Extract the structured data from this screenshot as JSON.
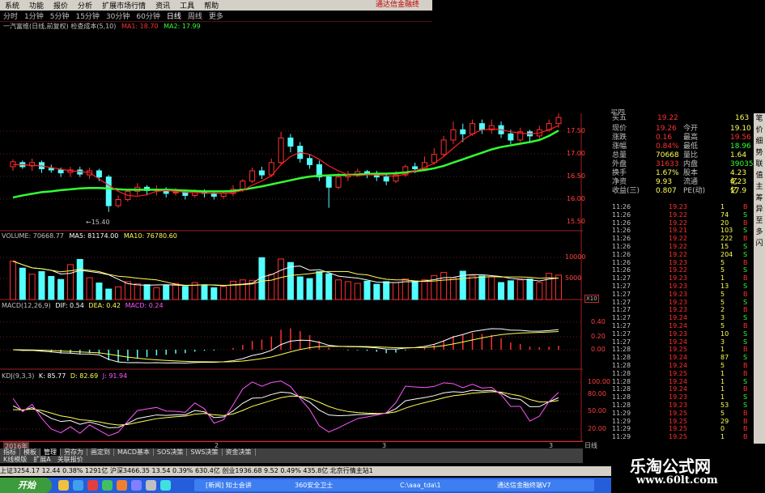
{
  "menu": [
    "系统",
    "功能",
    "报价",
    "分析",
    "扩展市场行情",
    "资讯",
    "工具",
    "帮助"
  ],
  "brand": "通达信金融终",
  "periods": [
    "分时",
    "1分钟",
    "5分钟",
    "15分钟",
    "30分钟",
    "60分钟",
    "日线",
    "周线",
    "更多"
  ],
  "active_period": "日线",
  "header": {
    "stock": "一汽富维(日线,前复权)",
    "indicator": "检查成本(5,10)",
    "ma1": "MA1: 18.70",
    "ma2": "MA2: 17.99"
  },
  "price_axis": [
    "17.50",
    "17.00",
    "16.50",
    "16.00",
    "15.50"
  ],
  "low_label": "15.40",
  "volume_header": {
    "label": "VOLUME: 70668.77",
    "ma5": "MA5: 81174.00",
    "ma10": "MA10: 76780.60"
  },
  "volume_axis": [
    "10000",
    "5000"
  ],
  "volume_unit": "X10",
  "macd_header": {
    "label": "MACD(12,26,9)",
    "dif": "DIF: 0.54",
    "dea": "DEA: 0.42",
    "macd": "MACD: 0.24"
  },
  "macd_axis": [
    "0.40",
    "0.20",
    "0.00"
  ],
  "kdj_header": {
    "label": "KDJ(9,3,3)",
    "k": "K: 85.77",
    "d": "D: 82.69",
    "j": "J: 91.94"
  },
  "kdj_axis": [
    "100.00",
    "80.00",
    "50.00",
    "20.00"
  ],
  "date_label": "2016年",
  "time_marks": [
    "2",
    "3",
    "3"
  ],
  "period_label": "日线",
  "quote": {
    "top_cut": "买四",
    "buy5": {
      "label": "买五",
      "price": "19.22",
      "vol": "163"
    },
    "rows": [
      {
        "l1": "现价",
        "v1": "19.26",
        "l2": "今开",
        "v2": "19.10"
      },
      {
        "l1": "涨跌",
        "v1": "0.16",
        "l2": "最高",
        "v2": "19.56"
      },
      {
        "l1": "涨幅",
        "v1": "0.84%",
        "l2": "最低",
        "v2": "18.96"
      },
      {
        "l1": "总量",
        "v1": "70668",
        "l2": "量比",
        "v2": "1.64"
      },
      {
        "l1": "外盘",
        "v1": "31633",
        "l2": "内盘",
        "v2": "39035"
      },
      {
        "l1": "换手",
        "v1": "1.67%",
        "l2": "股本",
        "v2": "4.23亿"
      },
      {
        "l1": "净资",
        "v1": "9.93",
        "l2": "流通",
        "v2": "4.23亿"
      },
      {
        "l1": "收益(三)",
        "v1": "0.807",
        "l2": "PE(动)",
        "v2": "17.9"
      }
    ],
    "ticks": [
      {
        "t": "11:26",
        "p": "19.23",
        "v": "1",
        "d": "B"
      },
      {
        "t": "11:26",
        "p": "19.22",
        "v": "74",
        "d": "S"
      },
      {
        "t": "11:26",
        "p": "19.22",
        "v": "20",
        "d": "B"
      },
      {
        "t": "11:26",
        "p": "19.21",
        "v": "103",
        "d": "S"
      },
      {
        "t": "11:26",
        "p": "19.22",
        "v": "222",
        "d": "B"
      },
      {
        "t": "11:26",
        "p": "19.22",
        "v": "15",
        "d": "S"
      },
      {
        "t": "11:26",
        "p": "19.22",
        "v": "204",
        "d": "S"
      },
      {
        "t": "11:26",
        "p": "19.23",
        "v": "5",
        "d": "B"
      },
      {
        "t": "11:26",
        "p": "19.22",
        "v": "5",
        "d": "S"
      },
      {
        "t": "11:27",
        "p": "19.23",
        "v": "1",
        "d": "B"
      },
      {
        "t": "11:27",
        "p": "19.23",
        "v": "13",
        "d": "S"
      },
      {
        "t": "11:27",
        "p": "19.23",
        "v": "5",
        "d": "B"
      },
      {
        "t": "11:27",
        "p": "19.23",
        "v": "5",
        "d": "S"
      },
      {
        "t": "11:27",
        "p": "19.23",
        "v": "2",
        "d": "B"
      },
      {
        "t": "11:27",
        "p": "19.24",
        "v": "3",
        "d": "S"
      },
      {
        "t": "11:27",
        "p": "19.24",
        "v": "5",
        "d": "B"
      },
      {
        "t": "11:27",
        "p": "19.23",
        "v": "10",
        "d": "S"
      },
      {
        "t": "11:27",
        "p": "19.24",
        "v": "3",
        "d": "S"
      },
      {
        "t": "11:28",
        "p": "19.25",
        "v": "1",
        "d": "B"
      },
      {
        "t": "11:28",
        "p": "19.24",
        "v": "87",
        "d": "S"
      },
      {
        "t": "11:28",
        "p": "19.24",
        "v": "5",
        "d": "B"
      },
      {
        "t": "11:28",
        "p": "19.25",
        "v": "1",
        "d": "B"
      },
      {
        "t": "11:28",
        "p": "19.24",
        "v": "1",
        "d": "S"
      },
      {
        "t": "11:28",
        "p": "19.24",
        "v": "1",
        "d": "B"
      },
      {
        "t": "11:28",
        "p": "19.23",
        "v": "1",
        "d": "S"
      },
      {
        "t": "11:28",
        "p": "19.23",
        "v": "53",
        "d": "S"
      },
      {
        "t": "11:29",
        "p": "19.25",
        "v": "5",
        "d": "B"
      },
      {
        "t": "11:29",
        "p": "19.25",
        "v": "29",
        "d": "B"
      },
      {
        "t": "11:29",
        "p": "19.25",
        "v": "0",
        "d": "B"
      },
      {
        "t": "11:29",
        "p": "19.25",
        "v": "1",
        "d": "B"
      }
    ]
  },
  "side_tabs": [
    "笔",
    "价",
    "细",
    "势",
    "联",
    "值",
    "主",
    "筹",
    "异",
    "至",
    "多",
    "闪"
  ],
  "subtabs": [
    "指标",
    "模板",
    "管理",
    "另存为",
    "画定到",
    "MACD基本",
    "SOS决策",
    "SWS决策",
    "资金决策"
  ],
  "subtabs2": [
    "K线模版",
    "扩展A",
    "关联报价"
  ],
  "status_bar": "上证3254.17  12.44  0.38%  1291亿  沪深3466.35  13.54  0.39%  630.4亿  创业1936.68  9.52  0.49%  435.8亿    北京行情主站1",
  "taskbar": {
    "start": "开始",
    "tasks": [
      "[新闻] 知士会讲",
      "360安全卫士",
      "C:\\aaa_tda\\1",
      "通达信金融终端V7"
    ]
  },
  "watermark": {
    "line1": "乐淘公式网",
    "line2": "www.60lt.com"
  },
  "chart_data": {
    "type": "candlestick",
    "price_ylim": [
      15.3,
      18.1
    ],
    "candles": [
      [
        16.8,
        16.92,
        16.7,
        16.98
      ],
      [
        16.9,
        16.8,
        16.75,
        16.95
      ],
      [
        16.82,
        16.9,
        16.7,
        17.0
      ],
      [
        16.9,
        16.75,
        16.65,
        16.95
      ],
      [
        16.76,
        16.72,
        16.65,
        16.85
      ],
      [
        16.72,
        16.65,
        16.55,
        16.78
      ],
      [
        16.66,
        16.72,
        16.55,
        16.8
      ],
      [
        16.72,
        16.62,
        16.55,
        16.8
      ],
      [
        16.6,
        16.7,
        16.5,
        16.78
      ],
      [
        16.7,
        16.55,
        16.45,
        16.75
      ],
      [
        16.55,
        15.85,
        15.7,
        16.6
      ],
      [
        15.85,
        16.0,
        15.8,
        16.1
      ],
      [
        16.0,
        16.2,
        15.95,
        16.25
      ],
      [
        16.2,
        16.3,
        16.1,
        16.4
      ],
      [
        16.3,
        16.22,
        16.1,
        16.35
      ],
      [
        16.22,
        16.25,
        16.1,
        16.35
      ],
      [
        16.25,
        16.15,
        16.05,
        16.3
      ],
      [
        16.16,
        16.18,
        16.1,
        16.28
      ],
      [
        16.18,
        16.1,
        16.0,
        16.25
      ],
      [
        16.1,
        16.2,
        16.05,
        16.25
      ],
      [
        16.2,
        16.15,
        16.05,
        16.25
      ],
      [
        16.15,
        16.08,
        16.0,
        16.22
      ],
      [
        16.08,
        16.15,
        16.02,
        16.2
      ],
      [
        16.15,
        16.25,
        16.08,
        16.35
      ],
      [
        16.25,
        16.45,
        16.18,
        16.5
      ],
      [
        16.45,
        16.7,
        16.4,
        16.78
      ],
      [
        16.7,
        16.6,
        16.5,
        16.8
      ],
      [
        16.6,
        16.9,
        16.55,
        17.0
      ],
      [
        16.9,
        17.5,
        16.85,
        17.65
      ],
      [
        17.5,
        17.3,
        17.15,
        17.6
      ],
      [
        17.3,
        17.0,
        16.9,
        17.4
      ],
      [
        17.0,
        16.85,
        16.75,
        17.1
      ],
      [
        16.85,
        16.55,
        16.45,
        16.95
      ],
      [
        16.55,
        16.3,
        15.8,
        16.6
      ],
      [
        16.3,
        16.55,
        16.25,
        16.65
      ],
      [
        16.55,
        16.62,
        16.45,
        16.7
      ],
      [
        16.62,
        16.68,
        16.55,
        16.75
      ],
      [
        16.68,
        16.62,
        16.52,
        16.72
      ],
      [
        16.62,
        16.55,
        16.45,
        16.7
      ],
      [
        16.55,
        16.45,
        16.35,
        16.62
      ],
      [
        16.45,
        16.6,
        16.4,
        16.7
      ],
      [
        16.6,
        16.8,
        16.55,
        16.85
      ],
      [
        16.8,
        16.75,
        16.65,
        16.9
      ],
      [
        16.75,
        16.9,
        16.7,
        17.05
      ],
      [
        16.9,
        17.1,
        16.85,
        17.25
      ],
      [
        17.1,
        17.45,
        17.05,
        17.55
      ],
      [
        17.45,
        17.7,
        17.35,
        17.9
      ],
      [
        17.7,
        17.6,
        17.4,
        17.85
      ],
      [
        17.6,
        17.85,
        17.55,
        17.95
      ],
      [
        17.85,
        17.7,
        17.6,
        17.95
      ],
      [
        17.7,
        17.8,
        17.6,
        17.95
      ],
      [
        17.8,
        17.6,
        17.5,
        17.9
      ],
      [
        17.6,
        17.45,
        17.35,
        17.7
      ],
      [
        17.45,
        17.65,
        17.4,
        17.75
      ],
      [
        17.65,
        17.55,
        17.4,
        17.7
      ],
      [
        17.55,
        17.7,
        17.45,
        17.8
      ],
      [
        17.7,
        17.85,
        17.65,
        17.95
      ],
      [
        17.85,
        18.0,
        17.75,
        18.1
      ]
    ],
    "ma1": [
      16.85,
      16.85,
      16.83,
      16.82,
      16.78,
      16.74,
      16.7,
      16.68,
      16.66,
      16.5,
      16.35,
      16.2,
      16.1,
      16.08,
      16.12,
      16.2,
      16.22,
      16.2,
      16.18,
      16.17,
      16.16,
      16.15,
      16.15,
      16.17,
      16.22,
      16.35,
      16.45,
      16.58,
      16.85,
      17.05,
      17.15,
      17.1,
      16.98,
      16.82,
      16.7,
      16.6,
      16.58,
      16.6,
      16.6,
      16.58,
      16.57,
      16.62,
      16.7,
      16.78,
      16.88,
      17.05,
      17.25,
      17.45,
      17.6,
      17.7,
      17.72,
      17.7,
      17.65,
      17.62,
      17.6,
      17.62,
      17.7,
      17.8
    ],
    "ma2": [
      16.05,
      16.1,
      16.14,
      16.18,
      16.2,
      16.23,
      16.25,
      16.27,
      16.28,
      16.28,
      16.27,
      16.25,
      16.24,
      16.24,
      16.24,
      16.24,
      16.24,
      16.23,
      16.22,
      16.21,
      16.2,
      16.2,
      16.2,
      16.21,
      16.24,
      16.28,
      16.32,
      16.37,
      16.42,
      16.47,
      16.52,
      16.56,
      16.58,
      16.59,
      16.6,
      16.6,
      16.61,
      16.62,
      16.63,
      16.63,
      16.64,
      16.66,
      16.69,
      16.72,
      16.76,
      16.82,
      16.9,
      16.98,
      17.06,
      17.14,
      17.22,
      17.28,
      17.32,
      17.36,
      17.4,
      17.45,
      17.55,
      17.68
    ],
    "volume": [
      8800,
      7200,
      5800,
      6400,
      5300,
      4600,
      8000,
      9200,
      5000,
      3800,
      2400,
      2900,
      4100,
      3600,
      3400,
      2700,
      3200,
      3700,
      3000,
      3900,
      3200,
      2700,
      3000,
      4200,
      4500,
      4400,
      9600,
      5800,
      9300,
      8500,
      5200,
      4800,
      6400,
      5900,
      4500,
      4100,
      3700,
      4200,
      3500,
      4100,
      3900,
      4700,
      4200,
      4500,
      5500,
      6200,
      4900,
      6500,
      5400,
      5400,
      5200,
      3900,
      4300,
      4500,
      4700,
      3900,
      6000,
      5600
    ],
    "volume_ylim": [
      0,
      13000
    ],
    "macd_ylim": [
      -0.5,
      0.6
    ],
    "kdj_ylim": [
      0,
      110
    ]
  }
}
